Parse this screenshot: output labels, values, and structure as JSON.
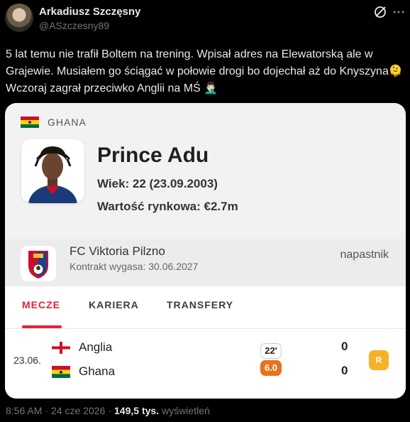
{
  "tweet": {
    "author_name": "Arkadiusz Szczęsny",
    "author_handle": "@ASzczesny89",
    "text": "5 lat temu nie trafił Boltem na trening. Wpisał adres na Elewatorską ale w Grajewie. Musiałem go ściągać w połowie drogi bo dojechał aż do Knyszyna🫠 Wczoraj zagrał przeciwko Anglii na MŚ 🤦🏻‍♂️"
  },
  "card": {
    "country": "GHANA",
    "player_name": "Prince Adu",
    "age": "Wiek: 22 (23.09.2003)",
    "market_value": "Wartość rynkowa: €2.7m",
    "club_name": "FC Viktoria Pilzno",
    "contract": "Kontrakt wygasa: 30.06.2027",
    "position": "napastnik",
    "tabs": [
      "MECZE",
      "KARIERA",
      "TRANSFERY"
    ],
    "active_tab": "MECZE",
    "match": {
      "date": "23.06.",
      "home_team": "Anglia",
      "away_team": "Ghana",
      "home_score": "0",
      "away_score": "0",
      "minutes": "22'",
      "rating": "6.0",
      "result": "R"
    }
  },
  "footer": {
    "time": "8:56 AM",
    "separator": "·",
    "date": "24 cze 2026",
    "views_separator": "·",
    "views": "149,5 tys.",
    "views_label": "wyświetleń"
  },
  "colors": {
    "accent_red": "#e2233c",
    "rating_orange": "#e8711c",
    "result_yellow": "#f6b225",
    "muted_gray": "#71767b"
  },
  "icons": [
    "grok-icon",
    "more-icon",
    "ghana-flag-icon",
    "england-flag-icon",
    "viktoria-plzen-crest-icon"
  ]
}
